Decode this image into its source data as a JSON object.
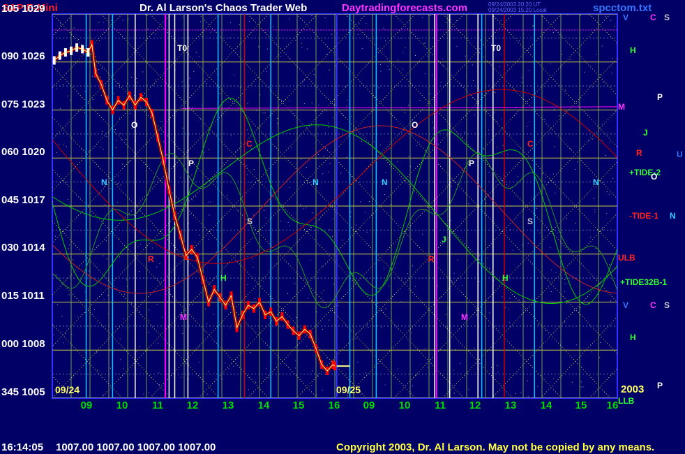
{
  "header": {
    "symbol": "S&P E-Mini",
    "title": "Dr. Al Larson's Chaos Trader Web",
    "site": "Daytradingforecasts.com",
    "stamp_line1": "09/24/2003 20:20 UT",
    "stamp_line2": "09/24/2003 15:20 Local",
    "filename": "spcctom.txt"
  },
  "footer": {
    "clock": "16:14:05",
    "quote": "1007.00 1007.00 1007.00 1007.00",
    "copyright": "Copyright 2003, Dr. Al Larson. May not be copied by any means."
  },
  "colors": {
    "background": "#000066",
    "price": "#ff0000",
    "price_today": "#ffffff",
    "tide": "#00cc00",
    "electric_field": "#cc0000",
    "grid_vertical": "#88cc44",
    "hour_marker": "#00ccff",
    "time_marker": "#ffffff",
    "magenta_line": "#ff00ff"
  },
  "chart_data": {
    "type": "line",
    "title": "S&P E-Mini",
    "y_ticks": [
      {
        "angle": "105",
        "price": "1029"
      },
      {
        "angle": "090",
        "price": "1026"
      },
      {
        "angle": "075",
        "price": "1023"
      },
      {
        "angle": "060",
        "price": "1020"
      },
      {
        "angle": "045",
        "price": "1017"
      },
      {
        "angle": "030",
        "price": "1014"
      },
      {
        "angle": "015",
        "price": "1011"
      },
      {
        "angle": "000",
        "price": "1008"
      },
      {
        "angle": "345",
        "price": "1005"
      }
    ],
    "ylim": [
      1005,
      1029
    ],
    "x_ticks": [
      "09",
      "10",
      "11",
      "12",
      "13",
      "14",
      "15",
      "16",
      "09",
      "10",
      "11",
      "12",
      "13",
      "14",
      "15",
      "16"
    ],
    "x_range": [
      8.5,
      23.5
    ],
    "date_labels": [
      "09/24",
      "09/25"
    ],
    "year_label": "2003",
    "series": [
      {
        "x": [
          8.55,
          8.7,
          8.85,
          9.0,
          9.15,
          9.3,
          9.45,
          9.55,
          9.65,
          9.8,
          9.95,
          10.1,
          10.25,
          10.4,
          10.55,
          10.7,
          10.85,
          11.0,
          11.15,
          11.3,
          11.45,
          11.6,
          11.75,
          11.9,
          12.05,
          12.2,
          12.35,
          12.5,
          12.65,
          12.8,
          12.95,
          13.1,
          13.25,
          13.4,
          13.55,
          13.7,
          13.85,
          14.0,
          14.15,
          14.3,
          14.45,
          14.6,
          14.75,
          14.9,
          15.05,
          15.2,
          15.35,
          15.5,
          15.65,
          15.8,
          15.95,
          16.0
        ],
        "values": [
          1026.1,
          1026.4,
          1026.6,
          1026.7,
          1026.9,
          1026.8,
          1026.6,
          1027.1,
          1025.3,
          1024.6,
          1023.6,
          1023.0,
          1023.6,
          1023.3,
          1023.9,
          1023.3,
          1023.8,
          1023.5,
          1022.8,
          1021.3,
          1019.8,
          1018.0,
          1016.4,
          1015.2,
          1013.9,
          1014.3,
          1013.8,
          1012.4,
          1011.0,
          1011.8,
          1011.3,
          1010.8,
          1011.4,
          1009.4,
          1010.2,
          1010.8,
          1010.6,
          1011.0,
          1010.2,
          1010.4,
          1009.8,
          1010.1,
          1009.6,
          1009.2,
          1008.9,
          1009.3,
          1009.0,
          1008.1,
          1007.1,
          1006.7,
          1007.1,
          1007.0
        ]
      }
    ],
    "today_close": 1007.0,
    "vertical_markers": [
      {
        "label": "T0",
        "x": 11.55
      },
      {
        "label": "O",
        "x": 10.3
      },
      {
        "label": "P",
        "x": 12.0
      },
      {
        "label": "C",
        "x": 13.65
      },
      {
        "label": "S",
        "x": 13.65
      },
      {
        "label": "N",
        "x": 9.55
      },
      {
        "label": "N",
        "x": 14.55
      },
      {
        "label": "R",
        "x": 10.85
      },
      {
        "label": "M",
        "x": 11.75
      },
      {
        "label": "H",
        "x": 12.85
      },
      {
        "label": "T0",
        "x": 19.3
      },
      {
        "label": "O",
        "x": 18.3
      },
      {
        "label": "P",
        "x": 19.95
      },
      {
        "label": "C",
        "x": 20.5
      },
      {
        "label": "S",
        "x": 20.55
      },
      {
        "label": "N",
        "x": 16.45
      },
      {
        "label": "N",
        "x": 22.45
      },
      {
        "label": "R",
        "x": 18.75
      },
      {
        "label": "M",
        "x": 19.65
      },
      {
        "label": "H",
        "x": 20.35
      },
      {
        "label": "J",
        "x": 18.95
      }
    ],
    "right_labels": [
      "V",
      "C",
      "S",
      "H",
      "P",
      "M",
      "J",
      "R",
      "U",
      "+TIDE-2",
      "O",
      "-TIDE-1",
      "N",
      "ULB",
      "+TIDE32B-1",
      "V",
      "C",
      "S",
      "H",
      "P",
      "LLB"
    ]
  }
}
